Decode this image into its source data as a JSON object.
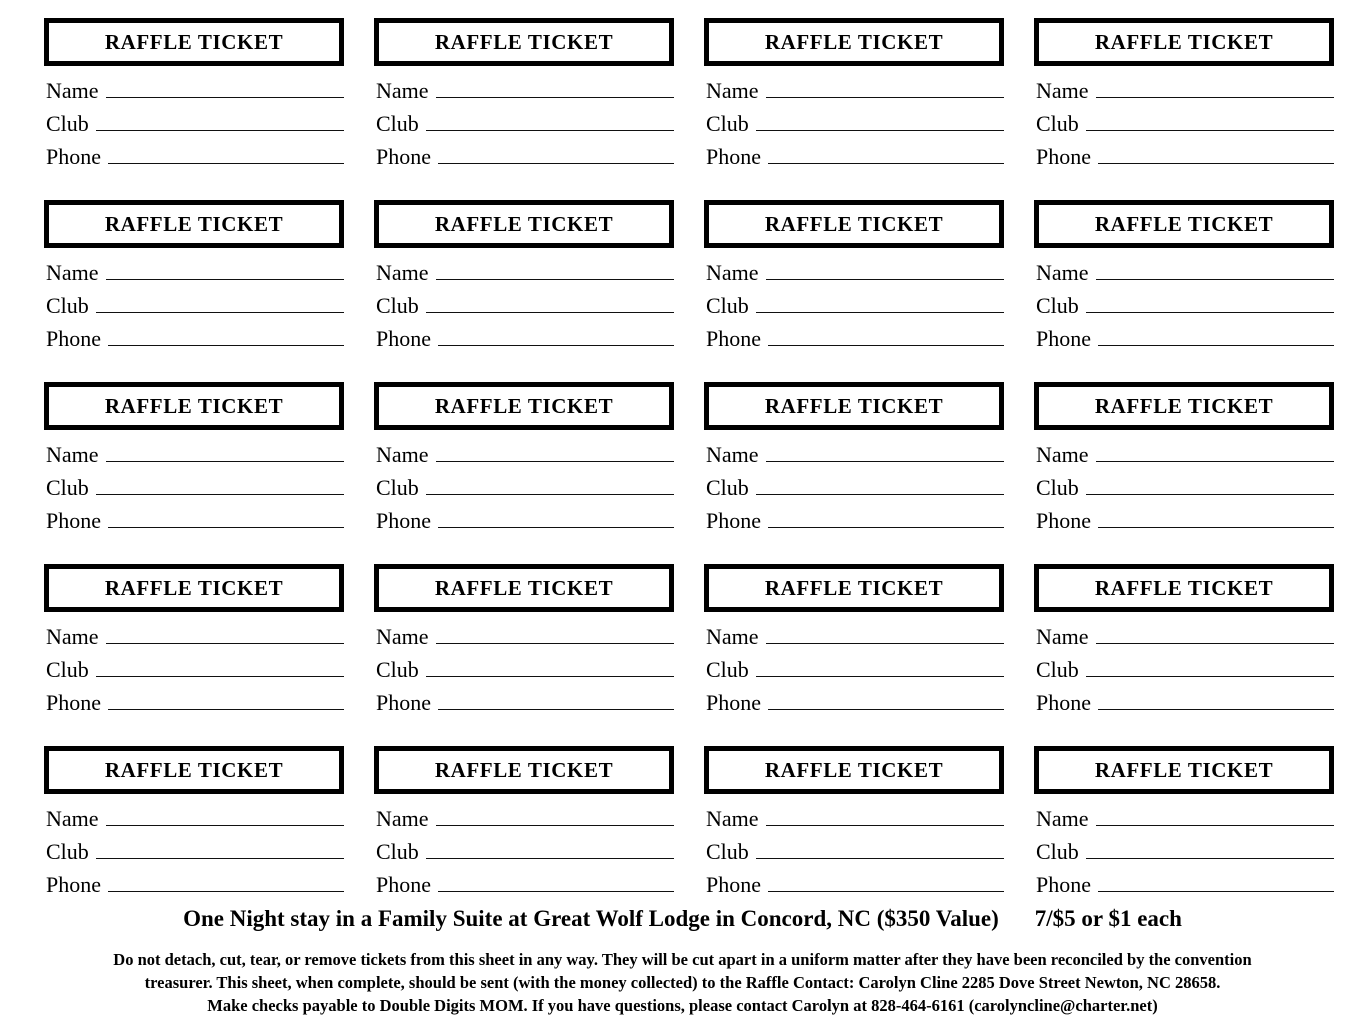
{
  "document": {
    "ticket_title": "RAFFLE TICKET",
    "ticket_count": 20,
    "columns": 4,
    "rows": 5,
    "fields": [
      "Name",
      "Club",
      "Phone"
    ]
  },
  "prize": {
    "description": "One Night stay in a Family Suite at Great Wolf  Lodge in Concord, NC  ($350 Value)",
    "pricing": "7/$5 or $1 each"
  },
  "instructions": {
    "line1": "Do not detach, cut, tear, or remove tickets from this sheet in any way.  They will be cut apart in a uniform matter after they have been reconciled by the convention",
    "line2": "treasurer.  This sheet, when complete, should be sent (with the money collected) to the Raffle Contact:  Carolyn Cline 2285 Dove Street Newton, NC 28658.",
    "line3": "Make checks payable to Double Digits MOM.    If you have questions, please contact Carolyn at 828-464-6161 (carolyncline@charter.net)"
  },
  "tickets": [
    {
      "title": "RAFFLE TICKET",
      "name_label": "Name",
      "club_label": "Club",
      "phone_label": "Phone",
      "name_value": "",
      "club_value": "",
      "phone_value": ""
    },
    {
      "title": "RAFFLE TICKET",
      "name_label": "Name",
      "club_label": "Club",
      "phone_label": "Phone",
      "name_value": "",
      "club_value": "",
      "phone_value": ""
    },
    {
      "title": "RAFFLE TICKET",
      "name_label": "Name",
      "club_label": "Club",
      "phone_label": "Phone",
      "name_value": "",
      "club_value": "",
      "phone_value": ""
    },
    {
      "title": "RAFFLE TICKET",
      "name_label": "Name",
      "club_label": "Club",
      "phone_label": "Phone",
      "name_value": "",
      "club_value": "",
      "phone_value": ""
    },
    {
      "title": "RAFFLE TICKET",
      "name_label": "Name",
      "club_label": "Club",
      "phone_label": "Phone",
      "name_value": "",
      "club_value": "",
      "phone_value": ""
    },
    {
      "title": "RAFFLE TICKET",
      "name_label": "Name",
      "club_label": "Club",
      "phone_label": "Phone",
      "name_value": "",
      "club_value": "",
      "phone_value": ""
    },
    {
      "title": "RAFFLE TICKET",
      "name_label": "Name",
      "club_label": "Club",
      "phone_label": "Phone",
      "name_value": "",
      "club_value": "",
      "phone_value": ""
    },
    {
      "title": "RAFFLE TICKET",
      "name_label": "Name",
      "club_label": "Club",
      "phone_label": "Phone",
      "name_value": "",
      "club_value": "",
      "phone_value": ""
    },
    {
      "title": "RAFFLE TICKET",
      "name_label": "Name",
      "club_label": "Club",
      "phone_label": "Phone",
      "name_value": "",
      "club_value": "",
      "phone_value": ""
    },
    {
      "title": "RAFFLE TICKET",
      "name_label": "Name",
      "club_label": "Club",
      "phone_label": "Phone",
      "name_value": "",
      "club_value": "",
      "phone_value": ""
    },
    {
      "title": "RAFFLE TICKET",
      "name_label": "Name",
      "club_label": "Club",
      "phone_label": "Phone",
      "name_value": "",
      "club_value": "",
      "phone_value": ""
    },
    {
      "title": "RAFFLE TICKET",
      "name_label": "Name",
      "club_label": "Club",
      "phone_label": "Phone",
      "name_value": "",
      "club_value": "",
      "phone_value": ""
    },
    {
      "title": "RAFFLE TICKET",
      "name_label": "Name",
      "club_label": "Club",
      "phone_label": "Phone",
      "name_value": "",
      "club_value": "",
      "phone_value": ""
    },
    {
      "title": "RAFFLE TICKET",
      "name_label": "Name",
      "club_label": "Club",
      "phone_label": "Phone",
      "name_value": "",
      "club_value": "",
      "phone_value": ""
    },
    {
      "title": "RAFFLE TICKET",
      "name_label": "Name",
      "club_label": "Club",
      "phone_label": "Phone",
      "name_value": "",
      "club_value": "",
      "phone_value": ""
    },
    {
      "title": "RAFFLE TICKET",
      "name_label": "Name",
      "club_label": "Club",
      "phone_label": "Phone",
      "name_value": "",
      "club_value": "",
      "phone_value": ""
    },
    {
      "title": "RAFFLE TICKET",
      "name_label": "Name",
      "club_label": "Club",
      "phone_label": "Phone",
      "name_value": "",
      "club_value": "",
      "phone_value": ""
    },
    {
      "title": "RAFFLE TICKET",
      "name_label": "Name",
      "club_label": "Club",
      "phone_label": "Phone",
      "name_value": "",
      "club_value": "",
      "phone_value": ""
    },
    {
      "title": "RAFFLE TICKET",
      "name_label": "Name",
      "club_label": "Club",
      "phone_label": "Phone",
      "name_value": "",
      "club_value": "",
      "phone_value": ""
    },
    {
      "title": "RAFFLE TICKET",
      "name_label": "Name",
      "club_label": "Club",
      "phone_label": "Phone",
      "name_value": "",
      "club_value": "",
      "phone_value": ""
    }
  ],
  "colors": {
    "ink": "#000000",
    "paper": "#ffffff",
    "rule": "#111111"
  }
}
